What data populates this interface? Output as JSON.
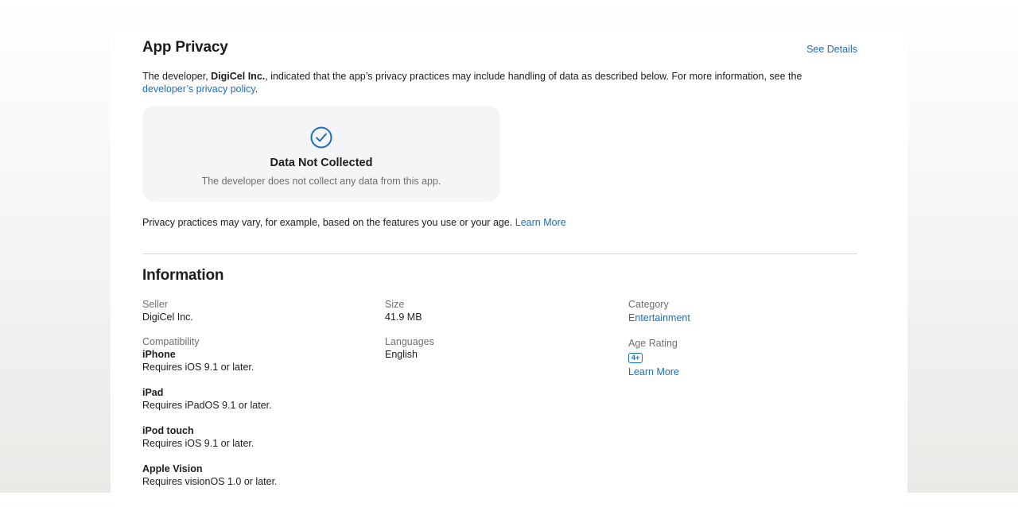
{
  "privacy": {
    "title": "App Privacy",
    "see_details": "See Details",
    "desc_prefix": "The developer, ",
    "developer_name": "DigiCel Inc.",
    "desc_suffix": ", indicated that the app’s privacy practices may include handling of data as described below. For more information, see the ",
    "policy_link": "developer’s privacy policy",
    "desc_end": ".",
    "box": {
      "icon": "checkmark-circle-icon",
      "title": "Data Not Collected",
      "subtitle": "The developer does not collect any data from this app."
    },
    "note": "Privacy practices may vary, for example, based on the features you use or your age.",
    "learn_more": "Learn More"
  },
  "information": {
    "title": "Information",
    "seller": {
      "label": "Seller",
      "value": "DigiCel Inc."
    },
    "size": {
      "label": "Size",
      "value": "41.9 MB"
    },
    "category": {
      "label": "Category",
      "value": "Entertainment"
    },
    "compatibility": {
      "label": "Compatibility",
      "devices": [
        {
          "name": "iPhone",
          "requirement": "Requires iOS 9.1 or later."
        },
        {
          "name": "iPad",
          "requirement": "Requires iPadOS 9.1 or later."
        },
        {
          "name": "iPod touch",
          "requirement": "Requires iOS 9.1 or later."
        },
        {
          "name": "Apple Vision",
          "requirement": "Requires visionOS 1.0 or later."
        }
      ]
    },
    "languages": {
      "label": "Languages",
      "value": "English"
    },
    "age_rating": {
      "label": "Age Rating",
      "badge": "4+",
      "learn_more": "Learn More"
    }
  },
  "colors": {
    "link": "#1a6ec0",
    "text": "#1d1d1f",
    "secondary_text": "#6e6e73",
    "box_background": "#f5f5f7"
  }
}
